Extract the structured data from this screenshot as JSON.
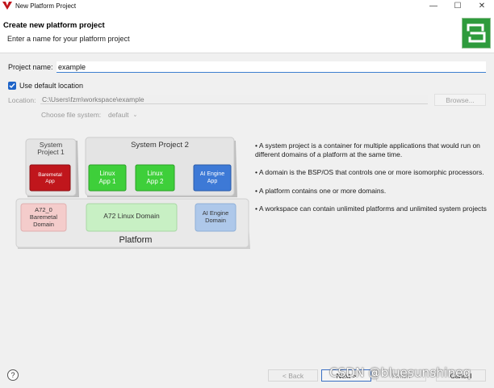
{
  "window": {
    "title": "New Platform Project",
    "minimize": "—",
    "maximize": "☐",
    "close": "✕"
  },
  "header": {
    "title": "Create new platform project",
    "subtitle": "Enter a name for your platform project"
  },
  "form": {
    "project_name_label": "Project name:",
    "project_name_value": "example",
    "use_default_label": "Use default location",
    "use_default_checked": true,
    "location_label": "Location:",
    "location_value": "C:\\Users\\fzm\\workspace\\example",
    "browse_label": "Browse...",
    "file_system_label": "Choose file system:",
    "file_system_value": "default"
  },
  "diagram": {
    "system_project_1": "System Project 1",
    "system_project_1_line1": "System",
    "system_project_1_line2": "Project 1",
    "baremetal_app_line1": "Baremetal",
    "baremetal_app_line2": "App",
    "system_project_2": "System Project 2",
    "linux_app_1_line1": "Linux",
    "linux_app_1_line2": "App 1",
    "linux_app_2_line1": "Linux",
    "linux_app_2_line2": "App 2",
    "ai_engine_app_line1": "AI Engine",
    "ai_engine_app_line2": "App",
    "a72_baremetal_line1": "A72_0",
    "a72_baremetal_line2": "Baremetal",
    "a72_baremetal_line3": "Domain",
    "a72_linux_domain": "A72 Linux Domain",
    "ai_engine_domain_line1": "AI Engine",
    "ai_engine_domain_line2": "Domain",
    "platform": "Platform"
  },
  "bullets": [
    "• A system project is a container for multiple applications that would run on different domains of a platform at the same time.",
    "• A domain is the BSP/OS that controls one or more isomorphic processors.",
    "• A platform contains one or more domains.",
    "• A workspace can contain unlimited platforms and unlimited system projects"
  ],
  "footer": {
    "help": "?",
    "back": "< Back",
    "next": "Next >",
    "finish": "Finish",
    "cancel": "Cancel"
  },
  "watermark": "CSDN @bluesunshineq",
  "colors": {
    "baremetal_app": "#c0161c",
    "linux_app": "#3ecf3a",
    "ai_engine_app": "#3d79d6",
    "ai_engine_domain": "#aec8ea",
    "linux_domain": "#c8f0c4",
    "baremetal_domain": "#f4cccb",
    "wizard_icon": "#2e9b3c"
  }
}
